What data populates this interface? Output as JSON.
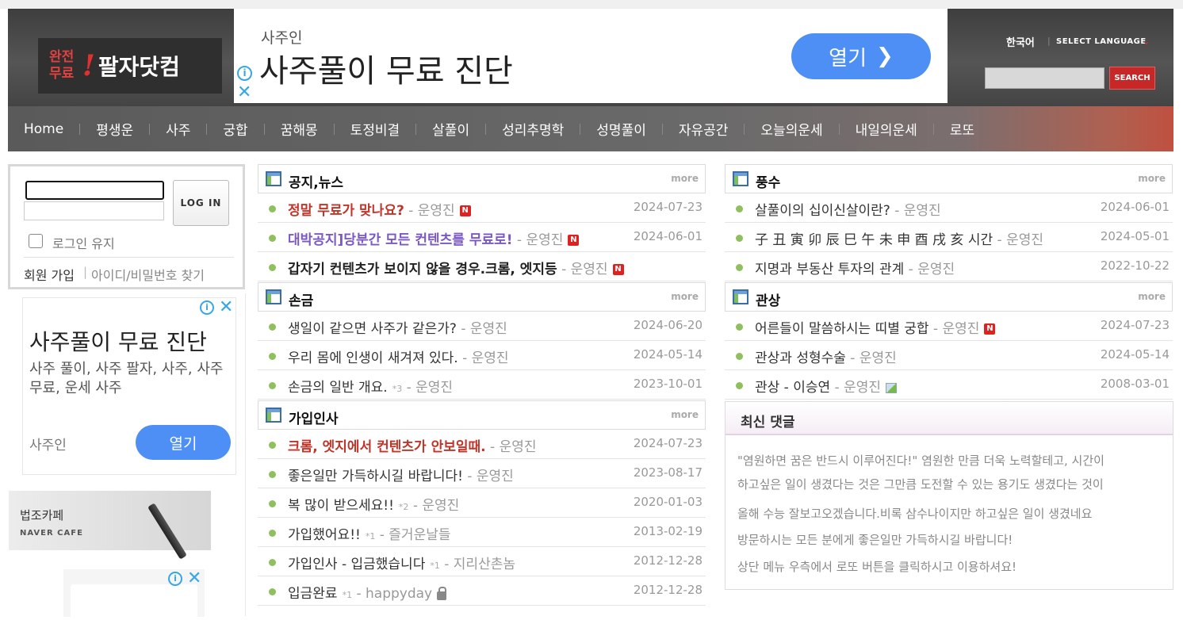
{
  "header": {
    "logo": {
      "small": "완전무료",
      "bang": "!",
      "main": "팔자닷컴"
    },
    "language": {
      "current": "한국어",
      "select": "SELECT LANGUAGE"
    },
    "search": {
      "button": "SEARCH",
      "value": ""
    }
  },
  "ad_top": {
    "advertiser": "사주인",
    "headline": "사주풀이 무료 진단",
    "button": "열기"
  },
  "nav": [
    "Home",
    "평생운",
    "사주",
    "궁합",
    "꿈해몽",
    "토정비결",
    "살풀이",
    "성리추명학",
    "성명풀이",
    "자유공간",
    "오늘의운세",
    "내일의운세",
    "로또"
  ],
  "login": {
    "button": "LOG IN",
    "keep_label": "로그인 유지",
    "join": "회원 가입",
    "separator": "|",
    "find": "아이디/비밀번호 찾기"
  },
  "ad_left": {
    "headline": "사주풀이 무료 진단",
    "description": "사주 풀이, 사주 팔자, 사주, 사주 무료, 운세 사주",
    "advertiser": "사주인",
    "button": "열기"
  },
  "cafe_banner": {
    "title": "법조카페",
    "subtitle": "NAVER CAFE"
  },
  "boards_left": [
    {
      "title": "공지,뉴스",
      "more": "more",
      "rows": [
        {
          "title": "정말 무료가 맞나요?",
          "author": "운영진",
          "date": "2024-07-23",
          "style": "hot-red",
          "new": "N"
        },
        {
          "title": "대박공지]당분간 모든 컨텐츠를 무료로!",
          "author": "운영진",
          "date": "2024-06-01",
          "style": "hot-purple",
          "new": "N"
        },
        {
          "title": "갑자기 컨텐츠가 보이지 않을 경우.크롬, 엣지등",
          "author": "운영진",
          "date": "",
          "style": "bold-dark",
          "new": "N"
        }
      ]
    },
    {
      "title": "손금",
      "more": "more",
      "rows": [
        {
          "title": "생일이 같으면 사주가 같은가?",
          "author": "운영진",
          "date": "2024-06-20"
        },
        {
          "title": "우리 몸에 인생이 새겨져 있다.",
          "author": "운영진",
          "date": "2024-05-14"
        },
        {
          "title": "손금의 일반 개요.",
          "count": "*3",
          "author": "운영진",
          "date": "2023-10-01"
        }
      ]
    },
    {
      "title": "가입인사",
      "more": "more",
      "rows": [
        {
          "title": "크롬, 엣지에서 컨텐츠가 안보일때.",
          "author": "운영진",
          "date": "2024-07-23",
          "style": "hot-red"
        },
        {
          "title": "좋은일만 가득하시길 바랍니다!",
          "author": "운영진",
          "date": "2023-08-17"
        },
        {
          "title": "복 많이 받으세요!!",
          "count": "*2",
          "author": "운영진",
          "date": "2020-01-03"
        },
        {
          "title": "가입했어요!!",
          "count": "*1",
          "author": "즐거운날들",
          "date": "2013-02-19"
        },
        {
          "title": "가입인사 - 입금했습니다",
          "count": "*1",
          "author": "지리산촌놈",
          "date": "2012-12-28"
        },
        {
          "title": "입금완료",
          "count": "*1",
          "author": "happyday",
          "date": "2012-12-28",
          "lock": true
        }
      ]
    }
  ],
  "boards_right": [
    {
      "title": "풍수",
      "more": "more",
      "rows": [
        {
          "title": "살풀이의 십이신살이란?",
          "author": "운영진",
          "date": "2024-06-01"
        },
        {
          "title": "子 丑 寅 卯 辰 巳 午 未 申 酉 戌 亥 시간",
          "author": "운영진",
          "date": "2024-05-01"
        },
        {
          "title": "지명과 부동산 투자의 관계",
          "author": "운영진",
          "date": "2022-10-22"
        }
      ]
    },
    {
      "title": "관상",
      "more": "more",
      "rows": [
        {
          "title": "어른들이 말씀하시는 띠별 궁합",
          "author": "운영진",
          "date": "2024-07-23",
          "new": "N"
        },
        {
          "title": "관상과 성형수술",
          "author": "운영진",
          "date": "2024-05-14"
        },
        {
          "title": "관상 - 이승연",
          "author": "운영진",
          "date": "2008-03-01",
          "image": true
        }
      ]
    }
  ],
  "comments": {
    "title": "최신 댓글",
    "items": [
      "\"염원하면 꿈은 반드시 이루어진다!\" 염원한 만큼 더욱 노력할테고, 시간이",
      "하고싶은 일이 생겼다는 것은 그만큼 도전할 수 있는 용기도 생겼다는 것이",
      "올해 수능 잘보고오겠습니다.비록 삼수나이지만 하고싶은 일이 생겼네요",
      "방문하시는 모든 분에게 좋은일만 가득하시길 바랍니다!",
      "상단 메뉴 우측에서 로또 버튼을 클릭하시고 이용하셔요!"
    ]
  }
}
